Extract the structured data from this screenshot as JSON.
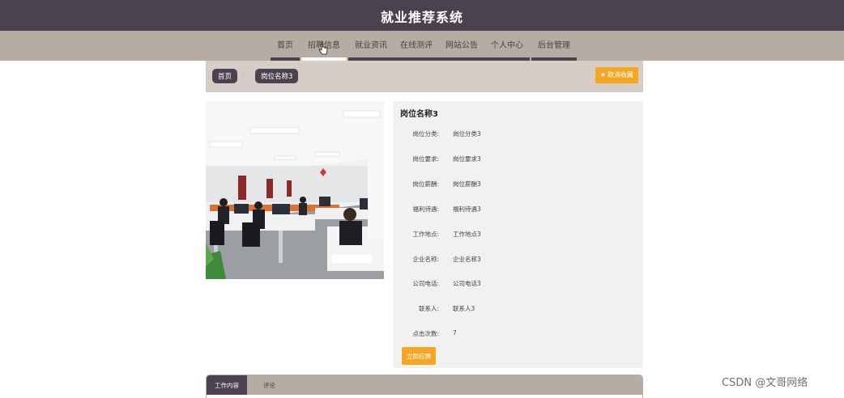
{
  "header": {
    "title": "就业推荐系统"
  },
  "nav": {
    "items": [
      {
        "label": "首页",
        "active": false
      },
      {
        "label": "招聘信息",
        "active": true
      },
      {
        "label": "就业资讯",
        "active": false
      },
      {
        "label": "在线测评",
        "active": false
      },
      {
        "label": "网站公告",
        "active": false
      },
      {
        "label": "个人中心",
        "active": false
      },
      {
        "label": "后台管理",
        "active": false
      }
    ]
  },
  "breadcrumb": {
    "home": "首页",
    "separator": "/",
    "current": "岗位名称3"
  },
  "favorite_button": {
    "label": "取消收藏",
    "icon": "star-icon"
  },
  "job": {
    "title": "岗位名称3",
    "fields": [
      {
        "label": "岗位分类:",
        "value": "岗位分类3"
      },
      {
        "label": "岗位要求:",
        "value": "岗位要求3"
      },
      {
        "label": "岗位薪酬:",
        "value": "岗位薪酬3"
      },
      {
        "label": "福利待遇:",
        "value": "福利待遇3"
      },
      {
        "label": "工作地点:",
        "value": "工作地点3"
      },
      {
        "label": "企业名称:",
        "value": "企业名称3"
      },
      {
        "label": "公司电话:",
        "value": "公司电话3"
      },
      {
        "label": "联系人:",
        "value": "联系人3"
      },
      {
        "label": "点击次数:",
        "value": "7"
      }
    ],
    "apply_label": "立即应聘"
  },
  "tabs": [
    {
      "label": "工作内容",
      "active": true
    },
    {
      "label": "评论",
      "active": false
    }
  ],
  "watermark": "CSDN @文哥网络",
  "colors": {
    "header": "#4a424f",
    "nav": "#b7aca4",
    "accent": "#f5a623",
    "panel": "#f1f1f1"
  }
}
